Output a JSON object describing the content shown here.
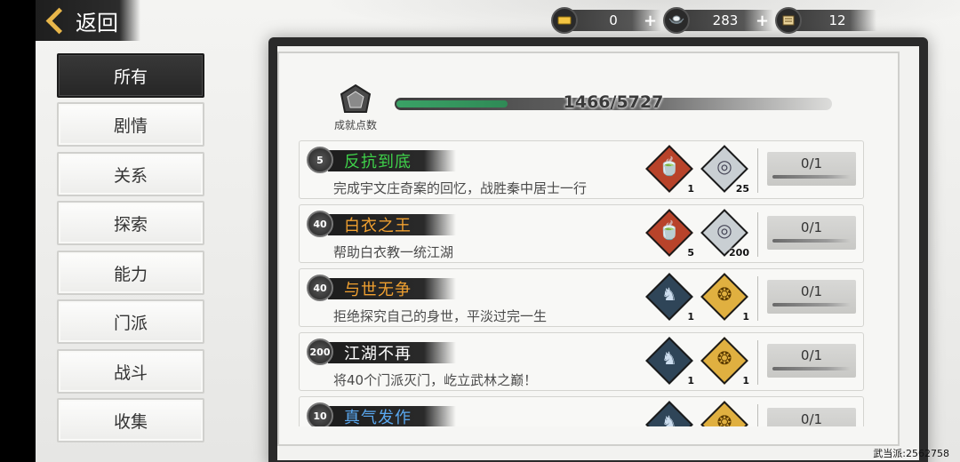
{
  "header": {
    "back_label": "返回",
    "currencies": [
      {
        "icon": "gold-ingot-icon",
        "value": "0"
      },
      {
        "icon": "silver-ingot-icon",
        "value": "283"
      },
      {
        "icon": "scroll-icon",
        "value": "12"
      }
    ],
    "plus_symbol": "+"
  },
  "sidebar": {
    "tabs": [
      {
        "label": "所有",
        "active": true
      },
      {
        "label": "剧情",
        "active": false
      },
      {
        "label": "关系",
        "active": false
      },
      {
        "label": "探索",
        "active": false
      },
      {
        "label": "能力",
        "active": false
      },
      {
        "label": "门派",
        "active": false
      },
      {
        "label": "战斗",
        "active": false
      },
      {
        "label": "收集",
        "active": false
      }
    ]
  },
  "points": {
    "label": "成就点数",
    "current": 1466,
    "total": 5727,
    "text": "1466/5727"
  },
  "achievements": [
    {
      "points": "5",
      "name": "反抗到底",
      "name_color": "#3fd14a",
      "desc": "完成宇文庄奇案的回忆，战胜秦中居士一行",
      "rewards": [
        {
          "icon": "tea-bowl-icon",
          "count": "1"
        },
        {
          "icon": "silver-ingot-icon",
          "count": "25"
        }
      ],
      "progress": "0/1"
    },
    {
      "points": "40",
      "name": "白衣之王",
      "name_color": "#f0a030",
      "desc": "帮助白衣教一统江湖",
      "rewards": [
        {
          "icon": "tea-bowl-icon",
          "count": "5"
        },
        {
          "icon": "silver-ingot-icon",
          "count": "200"
        }
      ],
      "progress": "0/1"
    },
    {
      "points": "40",
      "name": "与世无争",
      "name_color": "#f0a030",
      "desc": "拒绝探究自己的身世，平淡过完一生",
      "rewards": [
        {
          "icon": "warrior-icon",
          "count": "1"
        },
        {
          "icon": "golden-relic-icon",
          "count": "1"
        }
      ],
      "progress": "0/1"
    },
    {
      "points": "200",
      "name": "江湖不再",
      "name_color": "#ffffff",
      "desc": "将40个门派灭门，屹立武林之巅！",
      "rewards": [
        {
          "icon": "warrior-icon",
          "count": "1"
        },
        {
          "icon": "golden-relic-icon",
          "count": "1"
        }
      ],
      "progress": "0/1"
    },
    {
      "points": "10",
      "name": "真气发作",
      "name_color": "#5aa8f0",
      "desc": "",
      "rewards": [
        {
          "icon": "warrior-icon",
          "count": ""
        },
        {
          "icon": "golden-relic-icon",
          "count": ""
        }
      ],
      "progress": "0/1"
    }
  ],
  "footer": {
    "server": "武当派:2562758"
  }
}
